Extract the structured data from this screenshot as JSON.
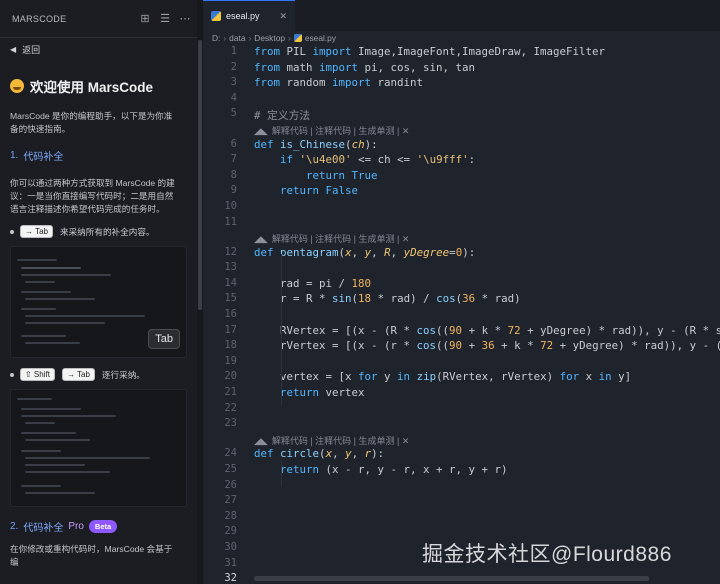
{
  "left_panel": {
    "header_title": "MARSCODE",
    "back_label": "返回",
    "welcome_title": "欢迎使用 MarsCode",
    "intro": "MarsCode 是你的编程助手，以下是为你准备的快速指南。",
    "section1": {
      "number": "1.",
      "title": "代码补全"
    },
    "section1_desc": "你可以通过两种方式获取到 MarsCode 的建议：一是当你直接编写代码时；二是用自然语言注释描述你希望代码完成的任务时。",
    "bullet1": {
      "key": "→ Tab",
      "text": "来采纳所有的补全内容。"
    },
    "tab_badge": "Tab",
    "bullet2": {
      "key1": "⇧ Shift",
      "key2": "→ Tab",
      "text": "逐行采纳。"
    },
    "section2": {
      "number": "2.",
      "title": "代码补全",
      "pro": "Pro",
      "badge": "Beta"
    },
    "section2_desc": "在你修改或重构代码时，MarsCode 会基于编"
  },
  "editor": {
    "tab_label": "eseal.py",
    "breadcrumbs": [
      "D:",
      "data",
      "Desktop",
      "eseal.py"
    ],
    "lens_text": "解释代码 | 注释代码 | 生成单测 | ✕",
    "lines": [
      {
        "n": 1,
        "html": "<span class='k'>from</span> PIL <span class='k'>import</span> Image,ImageFont,ImageDraw, ImageFilter"
      },
      {
        "n": 2,
        "html": "<span class='k'>from</span> math <span class='k'>import</span> pi, cos, sin, tan"
      },
      {
        "n": 3,
        "html": "<span class='k'>from</span> random <span class='k'>import</span> randint"
      },
      {
        "n": 4,
        "html": ""
      },
      {
        "n": 5,
        "html": "<span class='cm'># 定义方法</span>"
      },
      {
        "n": 6,
        "html": "<span class='k'>def</span> <span class='fn'>is_Chinese</span>(<span class='pr'>ch</span>):"
      },
      {
        "n": 7,
        "html": "    <span class='k'>if</span> <span class='st'>'\\u4e00'</span> &lt;= ch &lt;= <span class='st'>'\\u9fff'</span>:"
      },
      {
        "n": 8,
        "html": "        <span class='k'>return</span> <span class='k'>True</span>"
      },
      {
        "n": 9,
        "html": "    <span class='k'>return</span> <span class='k'>False</span>"
      },
      {
        "n": 10,
        "html": ""
      },
      {
        "n": 11,
        "html": ""
      },
      {
        "n": 12,
        "html": "<span class='k'>def</span> <span class='fn'>pentagram</span>(<span class='pr'>x</span>, <span class='pr'>y</span>, <span class='pr'>R</span>, <span class='pr'>yDegree</span>=<span class='nm'>0</span>):"
      },
      {
        "n": 13,
        "html": ""
      },
      {
        "n": 14,
        "html": "    rad = pi / <span class='nm'>180</span>"
      },
      {
        "n": 15,
        "html": "    r = R * <span class='fn'>sin</span>(<span class='nm'>18</span> * rad) / <span class='fn'>cos</span>(<span class='nm'>36</span> * rad)"
      },
      {
        "n": 16,
        "html": ""
      },
      {
        "n": 17,
        "html": "    RVertex = [(x - (R * <span class='fn'>cos</span>((<span class='nm'>90</span> + k * <span class='nm'>72</span> + yDegree) * rad)), y - (R * si"
      },
      {
        "n": 18,
        "html": "    rVertex = [(x - (r * <span class='fn'>cos</span>((<span class='nm'>90</span> + <span class='nm'>36</span> + k * <span class='nm'>72</span> + yDegree) * rad)), y - (r"
      },
      {
        "n": 19,
        "html": ""
      },
      {
        "n": 20,
        "html": "    vertex = [x <span class='k'>for</span> y <span class='k'>in</span> <span class='fn'>zip</span>(RVertex, rVertex) <span class='k'>for</span> x <span class='k'>in</span> y]"
      },
      {
        "n": 21,
        "html": "    <span class='k'>return</span> vertex"
      },
      {
        "n": 22,
        "html": ""
      },
      {
        "n": 23,
        "html": ""
      },
      {
        "n": 24,
        "html": "<span class='k'>def</span> <span class='fn'>circle</span>(<span class='pr'>x</span>, <span class='pr'>y</span>, <span class='pr'>r</span>):"
      },
      {
        "n": 25,
        "html": "    <span class='k'>return</span> (x - r, y - r, x + r, y + r)"
      },
      {
        "n": 26,
        "html": ""
      },
      {
        "n": 27,
        "html": ""
      },
      {
        "n": 28,
        "html": ""
      },
      {
        "n": 29,
        "html": ""
      },
      {
        "n": 30,
        "html": ""
      },
      {
        "n": 31,
        "html": ""
      },
      {
        "n": 32,
        "html": ""
      }
    ]
  },
  "watermark": "掘金技术社区@Flourd886",
  "colors": {
    "accent": "#2e78ff",
    "keyword": "#4fb6ff",
    "string": "#e6c07b",
    "beta": "#8f58ff"
  }
}
